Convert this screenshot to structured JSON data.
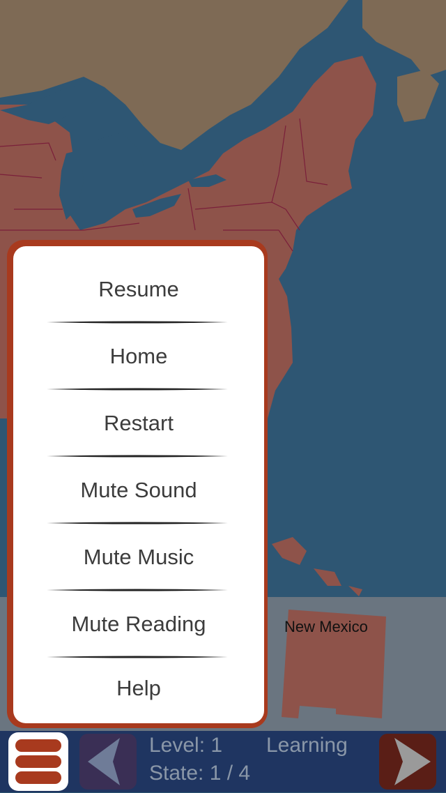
{
  "map": {
    "colors": {
      "ocean": "#2e5673",
      "states": "#8e534a",
      "canada": "#7e6a55",
      "borders": "#7a1f3a"
    }
  },
  "tray": {
    "piece_label": "New Mexico",
    "piece_color": "#8e534a"
  },
  "menu": {
    "items": [
      {
        "label": "Resume"
      },
      {
        "label": "Home"
      },
      {
        "label": "Restart"
      },
      {
        "label": "Mute Sound"
      },
      {
        "label": "Mute Music"
      },
      {
        "label": "Mute Reading"
      },
      {
        "label": "Help"
      }
    ],
    "frame_color": "#a83a1e"
  },
  "bottom_bar": {
    "level_label": "Level: 1",
    "mode_label": "Learning",
    "state_label": "State: 1 / 4",
    "menu_icon": "hamburger-icon",
    "prev_icon": "chevron-left-icon",
    "next_icon": "chevron-right-icon"
  }
}
